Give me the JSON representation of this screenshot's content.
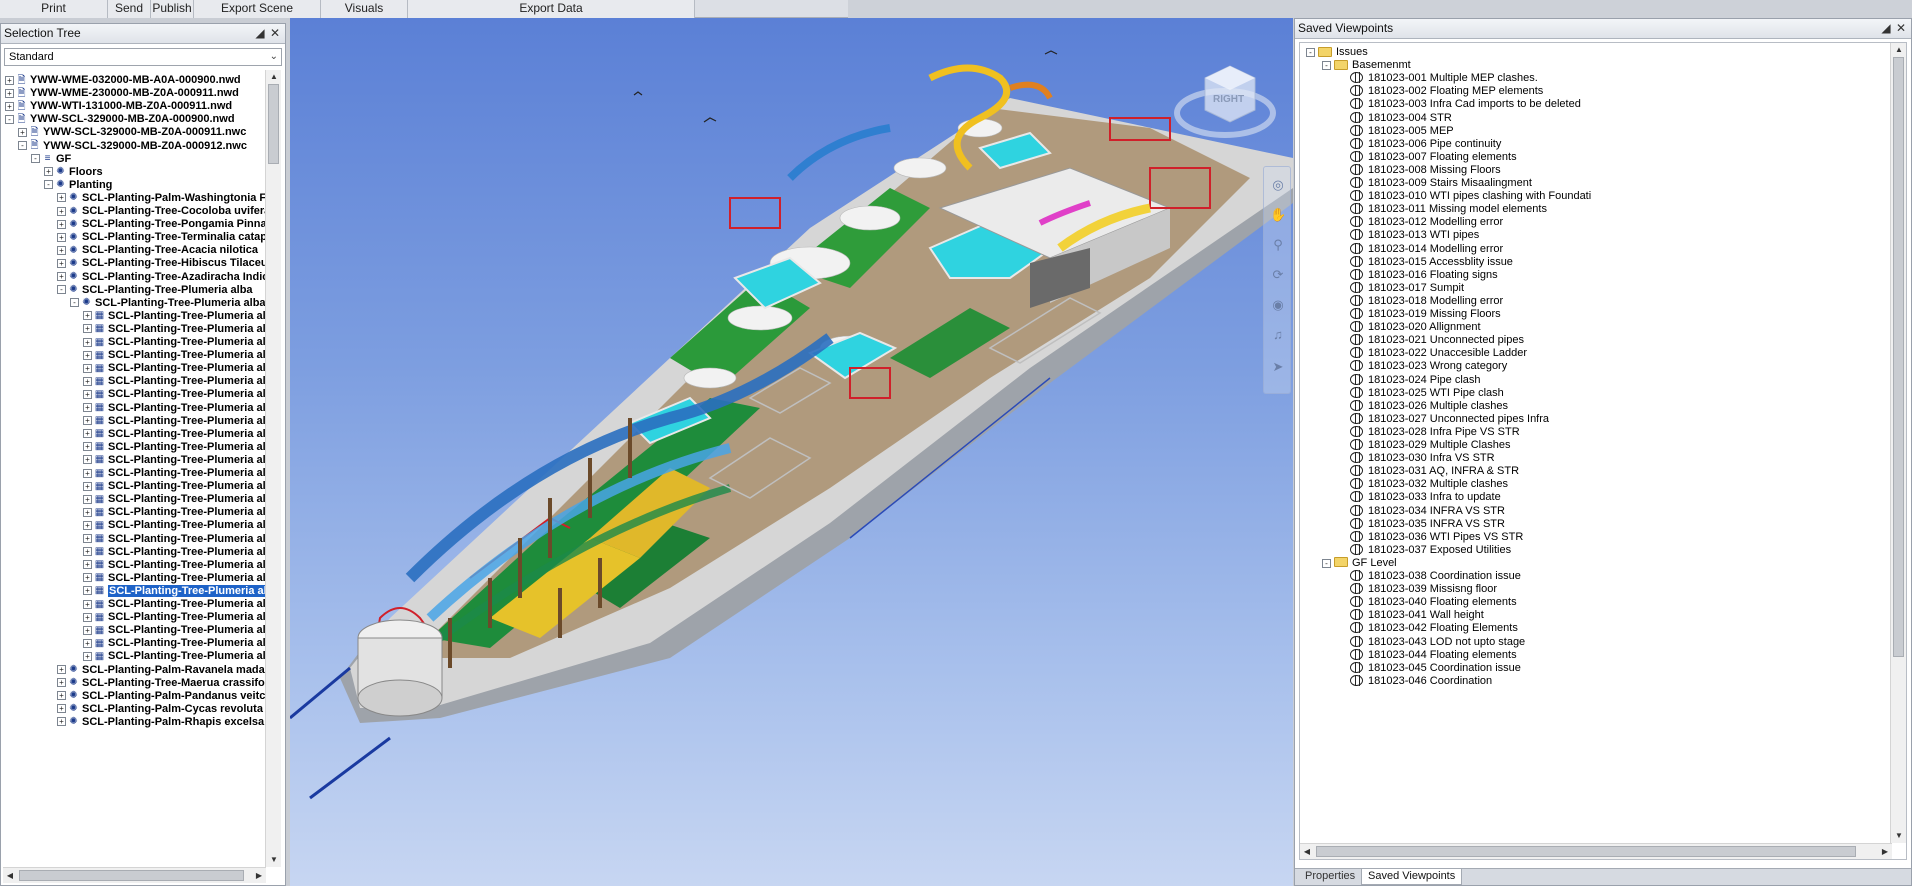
{
  "ribbon": {
    "groups": [
      {
        "label": "Print"
      },
      {
        "label": "Send"
      },
      {
        "label": "Publish"
      },
      {
        "label": "Export Scene"
      },
      {
        "label": "Visuals"
      },
      {
        "label": "Export Data"
      }
    ]
  },
  "selection_tree": {
    "title": "Selection Tree",
    "mode": "Standard",
    "nodes": [
      {
        "label": "YWW-WME-032000-MB-A0A-000900.nwd",
        "icon": "file-icon",
        "exp": "+"
      },
      {
        "label": "YWW-WME-230000-MB-Z0A-000911.nwd",
        "icon": "file-icon",
        "exp": "+"
      },
      {
        "label": "YWW-WTI-131000-MB-Z0A-000911.nwd",
        "icon": "file-icon",
        "exp": "+"
      },
      {
        "label": "YWW-SCL-329000-MB-Z0A-000900.nwd",
        "icon": "file-icon",
        "exp": "-"
      },
      {
        "label": "YWW-SCL-329000-MB-Z0A-000911.nwc",
        "icon": "file-icon",
        "exp": "+"
      },
      {
        "label": "YWW-SCL-329000-MB-Z0A-000912.nwc",
        "icon": "file-icon",
        "exp": "-"
      },
      {
        "label": "GF",
        "icon": "layer-icon",
        "exp": "-"
      },
      {
        "label": "Floors",
        "icon": "group-icon",
        "exp": "+"
      },
      {
        "label": "Planting",
        "icon": "group-icon",
        "exp": "-"
      },
      {
        "label": "SCL-Planting-Palm-Washingtonia Filife",
        "icon": "group-icon",
        "exp": "+"
      },
      {
        "label": "SCL-Planting-Tree-Cocoloba uvifera",
        "icon": "group-icon",
        "exp": "+"
      },
      {
        "label": "SCL-Planting-Tree-Pongamia Pinnata",
        "icon": "group-icon",
        "exp": "+"
      },
      {
        "label": "SCL-Planting-Tree-Terminalia catappa",
        "icon": "group-icon",
        "exp": "+"
      },
      {
        "label": "SCL-Planting-Tree-Acacia nilotica",
        "icon": "group-icon",
        "exp": "+"
      },
      {
        "label": "SCL-Planting-Tree-Hibiscus Tilaceus",
        "icon": "group-icon",
        "exp": "+"
      },
      {
        "label": "SCL-Planting-Tree-Azadiracha Indica",
        "icon": "group-icon",
        "exp": "+"
      },
      {
        "label": "SCL-Planting-Tree-Plumeria alba",
        "icon": "group-icon",
        "exp": "-"
      },
      {
        "label": "SCL-Planting-Tree-Plumeria alba",
        "icon": "group-icon",
        "exp": "-"
      },
      {
        "label": "SCL-Planting-Tree-Plumeria alba",
        "icon": "block-icon",
        "exp": "+"
      },
      {
        "label": "SCL-Planting-Tree-Plumeria alba",
        "icon": "block-icon",
        "exp": "+"
      },
      {
        "label": "SCL-Planting-Tree-Plumeria alba",
        "icon": "block-icon",
        "exp": "+"
      },
      {
        "label": "SCL-Planting-Tree-Plumeria alba",
        "icon": "block-icon",
        "exp": "+"
      },
      {
        "label": "SCL-Planting-Tree-Plumeria alba",
        "icon": "block-icon",
        "exp": "+"
      },
      {
        "label": "SCL-Planting-Tree-Plumeria alba",
        "icon": "block-icon",
        "exp": "+"
      },
      {
        "label": "SCL-Planting-Tree-Plumeria alba",
        "icon": "block-icon",
        "exp": "+"
      },
      {
        "label": "SCL-Planting-Tree-Plumeria alba",
        "icon": "block-icon",
        "exp": "+"
      },
      {
        "label": "SCL-Planting-Tree-Plumeria alba",
        "icon": "block-icon",
        "exp": "+"
      },
      {
        "label": "SCL-Planting-Tree-Plumeria alba",
        "icon": "block-icon",
        "exp": "+"
      },
      {
        "label": "SCL-Planting-Tree-Plumeria alba",
        "icon": "block-icon",
        "exp": "+"
      },
      {
        "label": "SCL-Planting-Tree-Plumeria alba",
        "icon": "block-icon",
        "exp": "+"
      },
      {
        "label": "SCL-Planting-Tree-Plumeria alba",
        "icon": "block-icon",
        "exp": "+"
      },
      {
        "label": "SCL-Planting-Tree-Plumeria alba",
        "icon": "block-icon",
        "exp": "+"
      },
      {
        "label": "SCL-Planting-Tree-Plumeria alba",
        "icon": "block-icon",
        "exp": "+"
      },
      {
        "label": "SCL-Planting-Tree-Plumeria alba",
        "icon": "block-icon",
        "exp": "+"
      },
      {
        "label": "SCL-Planting-Tree-Plumeria alba",
        "icon": "block-icon",
        "exp": "+"
      },
      {
        "label": "SCL-Planting-Tree-Plumeria alba",
        "icon": "block-icon",
        "exp": "+"
      },
      {
        "label": "SCL-Planting-Tree-Plumeria alba",
        "icon": "block-icon",
        "exp": "+"
      },
      {
        "label": "SCL-Planting-Tree-Plumeria alba",
        "icon": "block-icon",
        "exp": "+"
      },
      {
        "label": "SCL-Planting-Tree-Plumeria alba",
        "icon": "block-icon",
        "exp": "+"
      },
      {
        "label": "SCL-Planting-Tree-Plumeria alba",
        "icon": "block-icon",
        "exp": "+",
        "selected": true
      },
      {
        "label": "SCL-Planting-Tree-Plumeria alba",
        "icon": "block-icon",
        "exp": "+"
      },
      {
        "label": "SCL-Planting-Tree-Plumeria alba",
        "icon": "block-icon",
        "exp": "+"
      },
      {
        "label": "SCL-Planting-Tree-Plumeria alba",
        "icon": "block-icon",
        "exp": "+"
      },
      {
        "label": "SCL-Planting-Tree-Plumeria alba",
        "icon": "block-icon",
        "exp": "+"
      },
      {
        "label": "SCL-Planting-Tree-Plumeria alba",
        "icon": "block-icon",
        "exp": "+"
      },
      {
        "label": "SCL-Planting-Palm-Ravanela madagas",
        "icon": "group-icon",
        "exp": "+"
      },
      {
        "label": "SCL-Planting-Tree-Maerua crassifolia",
        "icon": "group-icon",
        "exp": "+"
      },
      {
        "label": "SCL-Planting-Palm-Pandanus veitchii",
        "icon": "group-icon",
        "exp": "+"
      },
      {
        "label": "SCL-Planting-Palm-Cycas revoluta",
        "icon": "group-icon",
        "exp": "+"
      },
      {
        "label": "SCL-Planting-Palm-Rhapis excelsa",
        "icon": "group-icon",
        "exp": "+"
      }
    ]
  },
  "viewport": {
    "viewcube_face": "RIGHT",
    "colors": {
      "sky_top": "#5b80d6",
      "sky_bottom": "#c7d6f2",
      "water": "#2fd3e0",
      "ground": "#b39a7a",
      "grass": "#1f8f3a",
      "steel": "#d8d8d8"
    }
  },
  "saved_viewpoints": {
    "title": "Saved Viewpoints",
    "folders": [
      {
        "label": "Issues"
      },
      {
        "label": "Basemenmt"
      },
      {
        "label": "GF Level"
      }
    ],
    "basement_items": [
      "181023-001 Multiple MEP clashes.",
      "181023-002 Floating MEP elements",
      "181023-003 Infra Cad imports to be deleted",
      "181023-004  STR",
      "181023-005 MEP",
      "181023-006 Pipe continuity",
      "181023-007  Floating elements",
      "181023-008  Missing Floors",
      "181023-009  Stairs Misaalingment",
      "181023-010  WTI pipes clashing with Foundati",
      "181023-011  Missing model elements",
      "181023-012  Modelling error",
      "181023-013 WTI pipes",
      "181023-014 Modelling error",
      "181023-015 Accessblity issue",
      "181023-016 Floating signs",
      "181023-017 Sumpit",
      "181023-018 Modelling error",
      "181023-019 Missing Floors",
      "181023-020  Allignment",
      "181023-021 Unconnected pipes",
      "181023-022 Unaccesible Ladder",
      "181023-023 Wrong category",
      "181023-024 Pipe clash",
      "181023-025 WTI Pipe clash",
      "181023-026 Multiple clashes",
      "181023-027 Unconnected pipes Infra",
      "181023-028 Infra Pipe VS STR",
      "181023-029 Multiple Clashes",
      "181023-030 Infra VS STR",
      "181023-031 AQ, INFRA & STR",
      "181023-032 Multiple clashes",
      "181023-033 Infra to update",
      "181023-034 INFRA VS STR",
      "181023-035 INFRA VS STR",
      "181023-036 WTI Pipes VS STR",
      "181023-037 Exposed Utilities"
    ],
    "gf_items": [
      "181023-038 Coordination issue",
      "181023-039 Missisng floor",
      "181023-040 Floating elements",
      "181023-041 Wall height",
      "181023-042 Floating Elements",
      "181023-043 LOD not upto stage",
      "181023-044 Floating elements",
      "181023-045 Coordination issue",
      "181023-046 Coordination"
    ],
    "tabs": [
      {
        "label": "Properties"
      },
      {
        "label": "Saved Viewpoints",
        "active": true
      }
    ]
  }
}
